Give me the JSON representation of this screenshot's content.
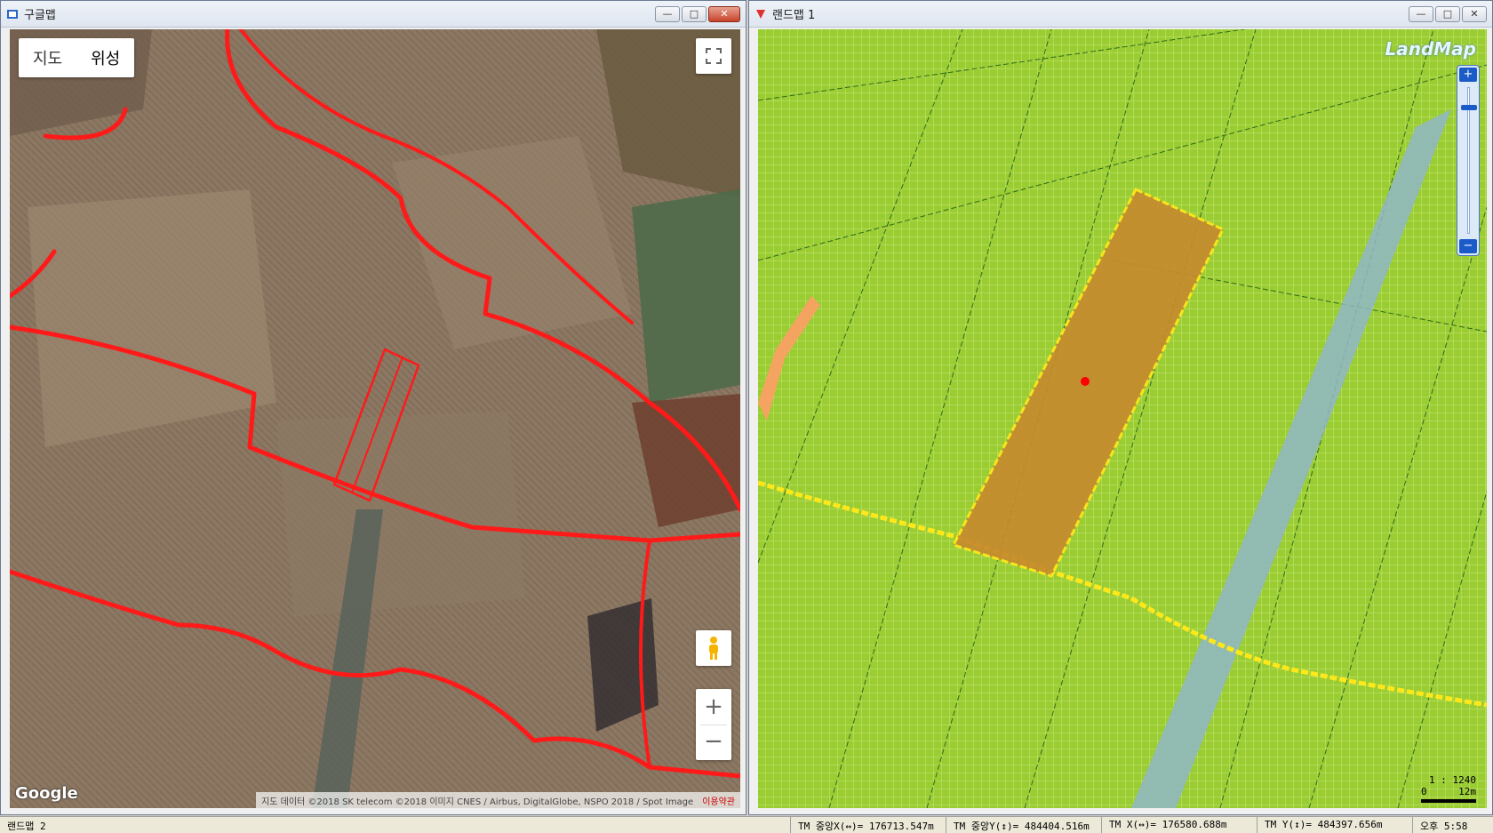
{
  "google_window": {
    "title": "구글맵",
    "map_type": [
      "지도",
      "위성"
    ],
    "logo": "Google",
    "attribution": "지도 데이터 ©2018 SK telecom ©2018 이미지 CNES / Airbus, DigitalGlobe, NSPO 2018 / Spot Image",
    "terms": "이용약관",
    "icons": {
      "fullscreen": "fullscreen-icon",
      "pegman": "pegman-icon",
      "zoom_in": "+",
      "zoom_out": "−"
    }
  },
  "landmap_window": {
    "title": "랜드맵 1",
    "logo": "LandMap",
    "zoom_in": "+",
    "zoom_out": "−",
    "scale_ratio": "1 : 1240",
    "scale_zero": "0",
    "scale_length": "12m"
  },
  "window_buttons": {
    "minimize": "—",
    "maximize": "□",
    "close": "✕"
  },
  "status_bar": {
    "app": "랜드맵 2",
    "tm_center_x": "TM 중앙X(↔)= 176713.547m",
    "tm_center_y": "TM 중앙Y(↕)= 484404.516m",
    "tm_x": "TM X(↔)= 176580.688m",
    "tm_y": "TM Y(↕)= 484397.656m",
    "clock": "오후 5:58"
  },
  "colors": {
    "parcel_line": "#ff1a1a",
    "landmap_bg": "#9acd32",
    "parcel_fill": "#c68a2e",
    "parcel_border": "#ffe81a",
    "road": "#f4a460",
    "river": "#8fb6c8"
  }
}
